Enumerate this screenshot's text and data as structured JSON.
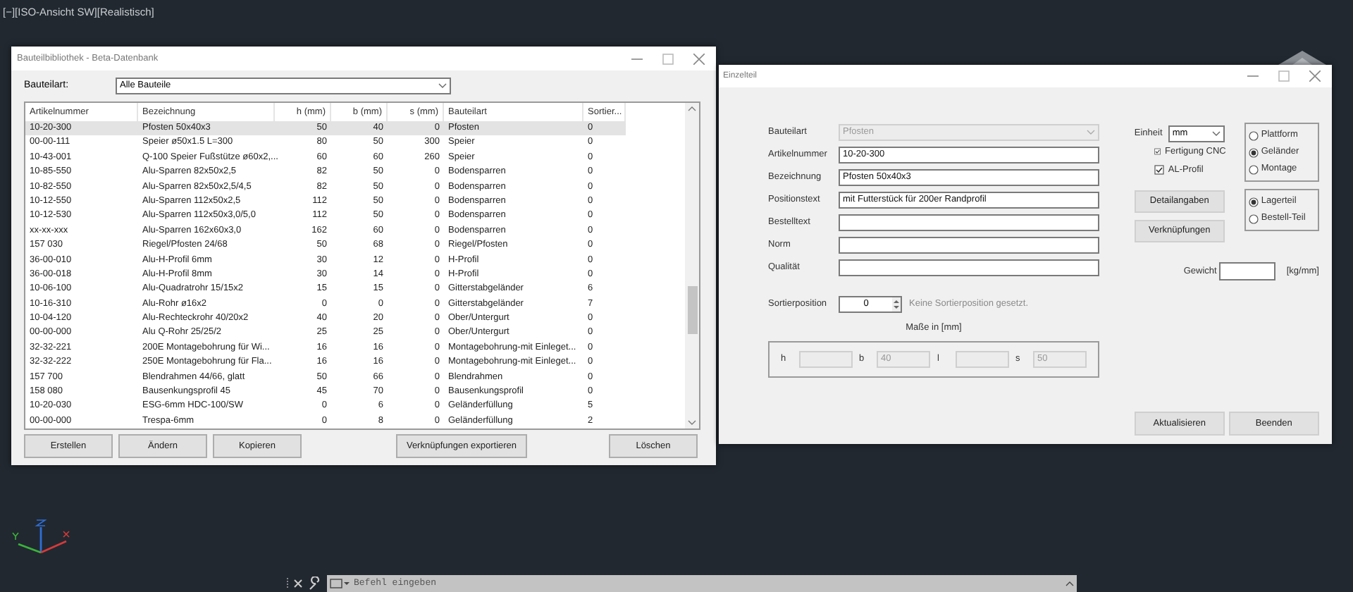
{
  "viewport": {
    "label": "[−][ISO-Ansicht SW][Realistisch]"
  },
  "library_window": {
    "title": "Bauteilbibliothek - Beta-Datenbank",
    "filter_label": "Bauteilart:",
    "filter_value": "Alle Bauteile",
    "columns": [
      "Artikelnummer",
      "Bezeichnung",
      "h (mm)",
      "b (mm)",
      "s (mm)",
      "Bauteilart",
      "Sortier..."
    ],
    "rows": [
      {
        "cells": [
          "10-20-300",
          "Pfosten 50x40x3",
          "50",
          "40",
          "0",
          "Pfosten",
          "0"
        ],
        "selected": true
      },
      {
        "cells": [
          "00-00-111",
          "Speier ø50x1.5 L=300",
          "80",
          "50",
          "300",
          "Speier",
          "0"
        ],
        "selected": false
      },
      {
        "cells": [
          "10-43-001",
          "Q-100 Speier Fußstütze ø60x2,...",
          "60",
          "60",
          "260",
          "Speier",
          "0"
        ],
        "selected": false
      },
      {
        "cells": [
          "10-85-550",
          "Alu-Sparren 82x50x2,5",
          "82",
          "50",
          "0",
          "Bodensparren",
          "0"
        ],
        "selected": false
      },
      {
        "cells": [
          "10-82-550",
          "Alu-Sparren 82x50x2,5/4,5",
          "82",
          "50",
          "0",
          "Bodensparren",
          "0"
        ],
        "selected": false
      },
      {
        "cells": [
          "10-12-550",
          "Alu-Sparren 112x50x2,5",
          "112",
          "50",
          "0",
          "Bodensparren",
          "0"
        ],
        "selected": false
      },
      {
        "cells": [
          "10-12-530",
          "Alu-Sparren 112x50x3,0/5,0",
          "112",
          "50",
          "0",
          "Bodensparren",
          "0"
        ],
        "selected": false
      },
      {
        "cells": [
          "xx-xx-xxx",
          "Alu-Sparren 162x60x3,0",
          "162",
          "60",
          "0",
          "Bodensparren",
          "0"
        ],
        "selected": false
      },
      {
        "cells": [
          "157 030",
          "Riegel/Pfosten 24/68",
          "50",
          "68",
          "0",
          "Riegel/Pfosten",
          "0"
        ],
        "selected": false
      },
      {
        "cells": [
          "36-00-010",
          "Alu-H-Profil 6mm",
          "30",
          "12",
          "0",
          "H-Profil",
          "0"
        ],
        "selected": false
      },
      {
        "cells": [
          "36-00-018",
          "Alu-H-Profil 8mm",
          "30",
          "14",
          "0",
          "H-Profil",
          "0"
        ],
        "selected": false
      },
      {
        "cells": [
          "10-06-100",
          "Alu-Quadratrohr 15/15x2",
          "15",
          "15",
          "0",
          "Gitterstabgeländer",
          "6"
        ],
        "selected": false
      },
      {
        "cells": [
          "10-16-310",
          "Alu-Rohr ø16x2",
          "0",
          "0",
          "0",
          "Gitterstabgeländer",
          "7"
        ],
        "selected": false
      },
      {
        "cells": [
          "10-04-120",
          "Alu-Rechteckrohr 40/20x2",
          "40",
          "20",
          "0",
          "Ober/Untergurt",
          "0"
        ],
        "selected": false
      },
      {
        "cells": [
          "00-00-000",
          "Alu Q-Rohr 25/25/2",
          "25",
          "25",
          "0",
          "Ober/Untergurt",
          "0"
        ],
        "selected": false
      },
      {
        "cells": [
          "32-32-221",
          "200E Montagebohrung für Wi...",
          "16",
          "16",
          "0",
          "Montagebohrung-mit Einleget...",
          "0"
        ],
        "selected": false
      },
      {
        "cells": [
          "32-32-222",
          "250E Montagebohrung für Fla...",
          "16",
          "16",
          "0",
          "Montagebohrung-mit Einleget...",
          "0"
        ],
        "selected": false
      },
      {
        "cells": [
          "157 700",
          "Blendrahmen 44/66, glatt",
          "50",
          "66",
          "0",
          "Blendrahmen",
          "0"
        ],
        "selected": false
      },
      {
        "cells": [
          "158 080",
          "Bausenkungsprofil 45",
          "45",
          "70",
          "0",
          "Bausenkungsprofil",
          "0"
        ],
        "selected": false
      },
      {
        "cells": [
          "10-20-030",
          "ESG-6mm HDC-100/SW",
          "0",
          "6",
          "0",
          "Geländerfüllung",
          "5"
        ],
        "selected": false
      },
      {
        "cells": [
          "00-00-000",
          "Trespa-6mm",
          "0",
          "8",
          "0",
          "Geländerfüllung",
          "2"
        ],
        "selected": false
      }
    ],
    "buttons": [
      "Erstellen",
      "Ändern",
      "Kopieren",
      "Verknüpfungen exportieren",
      "Löschen"
    ]
  },
  "detail_window": {
    "title": "Einzelteil",
    "fields": [
      {
        "label": "Bauteilart",
        "value": "Pfosten",
        "kind": "combo",
        "disabled": true
      },
      {
        "label": "Artikelnummer",
        "value": "10-20-300",
        "kind": "text",
        "disabled": false
      },
      {
        "label": "Bezeichnung",
        "value": "Pfosten 50x40x3",
        "kind": "text",
        "disabled": false
      },
      {
        "label": "Positionstext",
        "value": "mit Futterstück für 200er Randprofil",
        "kind": "text",
        "disabled": false
      },
      {
        "label": "Bestelltext",
        "kind": "text",
        "disabled": false
      },
      {
        "label": "Norm",
        "kind": "text",
        "disabled": false
      },
      {
        "label": "Qualität",
        "kind": "text",
        "disabled": false
      }
    ],
    "sort": {
      "label": "Sortierposition",
      "value": "0",
      "hint": "Keine Sortierposition gesetzt."
    },
    "dimensions": {
      "title": "Maße in [mm]",
      "items": [
        {
          "label": "h",
          "disabled": true
        },
        {
          "label": "b",
          "value": "40",
          "disabled": true
        },
        {
          "label": "l",
          "disabled": true
        },
        {
          "label": "s",
          "value": "50",
          "disabled": true
        }
      ]
    },
    "unit": {
      "label": "Einheit",
      "value": "mm"
    },
    "checkboxes": [
      {
        "label": "Fertigung CNC",
        "checked": true
      },
      {
        "label": "AL-Profil",
        "checked": true
      }
    ],
    "side_buttons": [
      "Detailangaben",
      "Verknüpfungen"
    ],
    "category_radios": [
      {
        "label": "Plattform",
        "selected": false
      },
      {
        "label": "Geländer",
        "selected": true
      },
      {
        "label": "Montage",
        "selected": false
      }
    ],
    "stock_radios": [
      {
        "label": "Lagerteil",
        "selected": true
      },
      {
        "label": "Bestell-Teil",
        "selected": false
      }
    ],
    "weight": {
      "label": "Gewicht",
      "unit": "[kg/mm]"
    },
    "buttons": [
      "Aktualisieren",
      "Beenden"
    ]
  },
  "command_line": {
    "placeholder": "Befehl eingeben"
  }
}
